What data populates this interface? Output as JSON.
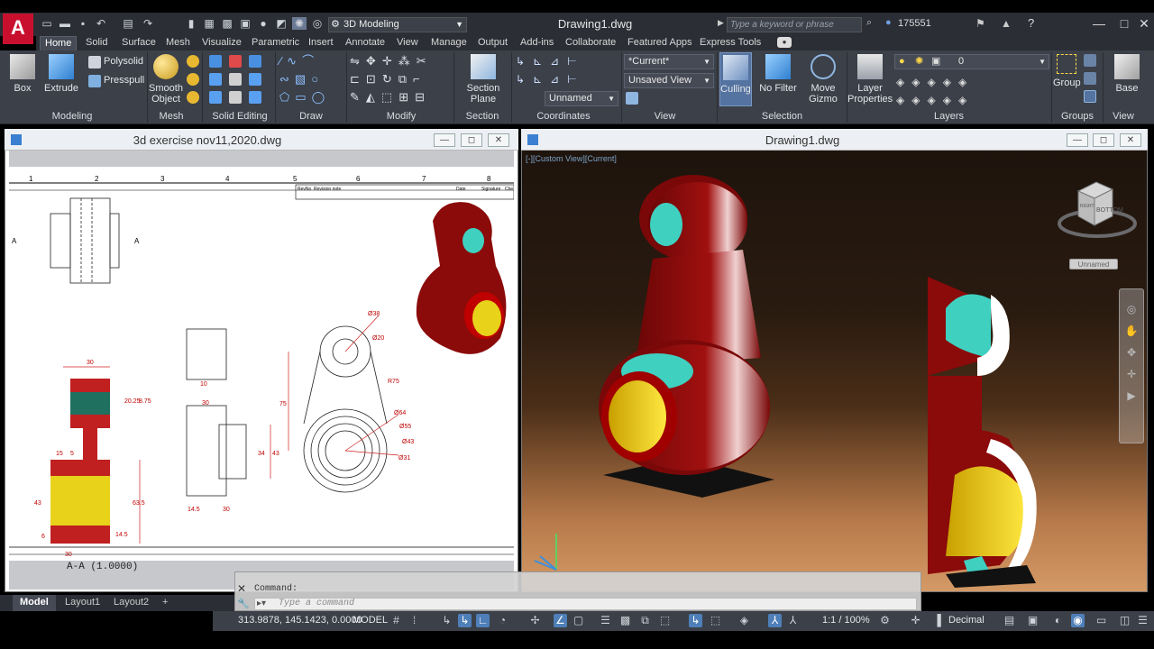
{
  "app": {
    "workspace": "3D Modeling",
    "doc_title": "Drawing1.dwg",
    "search_placeholder": "Type a keyword or phrase",
    "user": "175551"
  },
  "tabs": [
    "Home",
    "Solid",
    "Surface",
    "Mesh",
    "Visualize",
    "Parametric",
    "Insert",
    "Annotate",
    "View",
    "Manage",
    "Output",
    "Add-ins",
    "Collaborate",
    "Featured Apps",
    "Express Tools"
  ],
  "ribbon": {
    "box": "Box",
    "extrude": "Extrude",
    "polysolid": "Polysolid",
    "presspull": "Presspull",
    "smooth1": "Smooth",
    "smooth2": "Object",
    "section1": "Section",
    "section2": "Plane",
    "current": "*Current*",
    "unsaved_view": "Unsaved View",
    "unnamed": "Unnamed",
    "culling": "Culling",
    "no_filter": "No Filter",
    "move1": "Move",
    "move2": "Gizmo",
    "layer1": "Layer",
    "layer2": "Properties",
    "layer_value": "0",
    "group": "Group",
    "base": "Base",
    "panels": {
      "modeling": "Modeling",
      "mesh": "Mesh",
      "solid_editing": "Solid Editing",
      "draw": "Draw",
      "modify": "Modify",
      "section": "Section",
      "coordinates": "Coordinates",
      "view": "View",
      "selection": "Selection",
      "layers": "Layers",
      "groups": "Groups",
      "view2": "View"
    }
  },
  "left_window": {
    "title": "3d exercise nov11,2020.dwg",
    "scale": "A-A (1.0000)",
    "ruler": [
      "1",
      "2",
      "3",
      "4",
      "5",
      "6",
      "7",
      "8"
    ],
    "title_block": [
      "RevNo",
      "Revision note",
      "Date",
      "Signature",
      "Che"
    ],
    "dims": [
      "30",
      "20.25",
      "8.75",
      "15",
      "5",
      "43",
      "63.5",
      "6",
      "14.5",
      "30",
      "10",
      "30",
      "34",
      "43",
      "14.5",
      "30",
      "Ø38",
      "Ø20",
      "R75",
      "75",
      "Ø64",
      "Ø55",
      "Ø43",
      "Ø31"
    ],
    "section_marks": [
      "A",
      "A"
    ]
  },
  "right_window": {
    "title": "Drawing1.dwg",
    "vp_controls": "[-][Custom View][Current]",
    "viewcube_face": "BOTTOM",
    "viewcube_side": "RIGHT",
    "unnamed": "Unnamed"
  },
  "command": {
    "history": "Command:",
    "placeholder": "Type a command"
  },
  "layout_tabs": [
    "Model",
    "Layout1",
    "Layout2",
    "+"
  ],
  "status": {
    "coords": "313.9878, 145.1423, 0.0000",
    "model": "MODEL",
    "scale": "1:1 / 100%",
    "units": "Decimal"
  },
  "colors": {
    "accent": "#c8102e",
    "ribbon": "#3b4049",
    "part_red": "#8b0a0a",
    "part_cyan": "#3fd0c0",
    "part_yellow": "#e8d21a"
  }
}
